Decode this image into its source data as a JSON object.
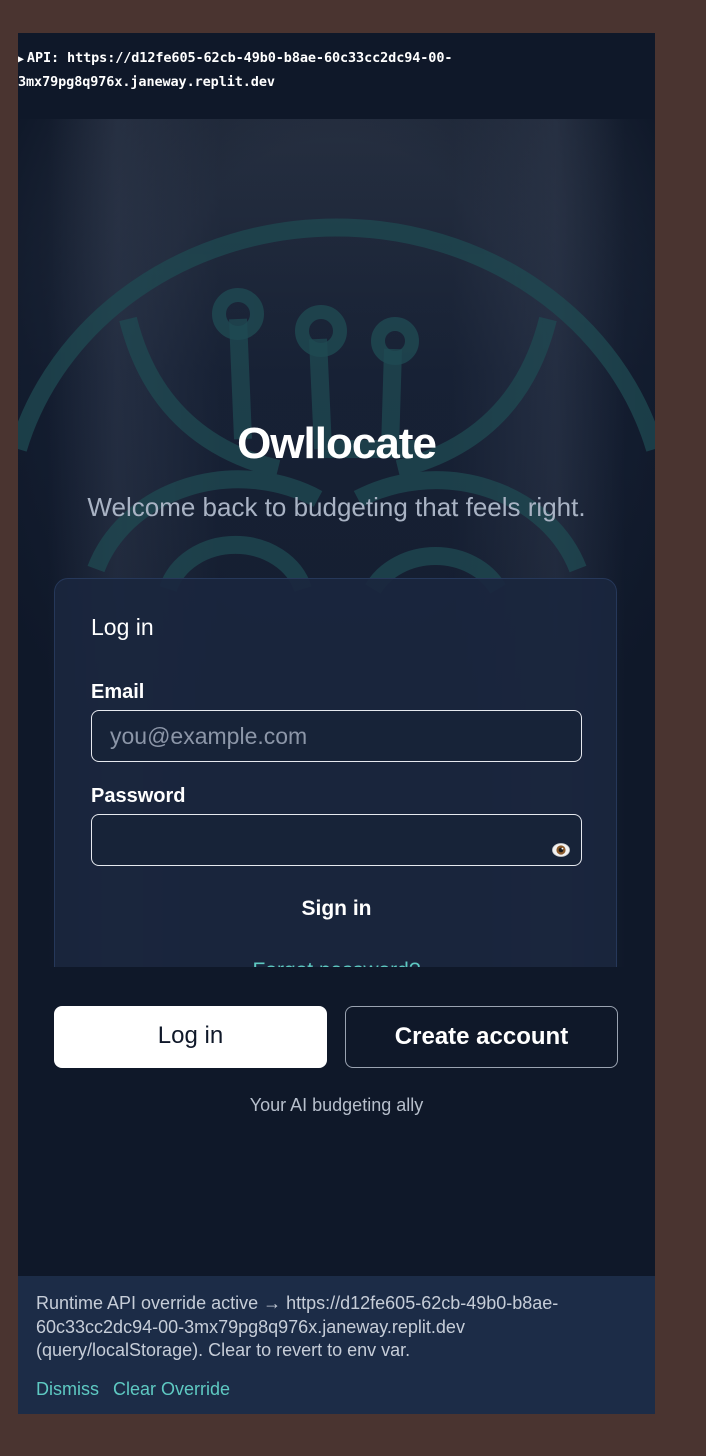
{
  "debug": {
    "api_label": "API: https://d12fe605-62cb-49b0-b8ae-60c33cc2dc94-00-3mx79pg8q976x.janeway.replit.dev",
    "api_line1": "API: https://d12fe605-62cb-49b0-b8ae-60c33cc2dc94-00-",
    "api_line2": "3mx79pg8q976x.janeway.replit.dev"
  },
  "hero": {
    "title": "Owllocate",
    "subtitle": "Welcome back to budgeting that feels right."
  },
  "login_card": {
    "title": "Log in",
    "email_label": "Email",
    "email_placeholder": "you@example.com",
    "email_value": "",
    "password_label": "Password",
    "password_value": "",
    "toggle_icon": "eye-icon",
    "signin_label": "Sign in",
    "forgot_label": "Forgot password?"
  },
  "actions": {
    "login_label": "Log in",
    "create_label": "Create account"
  },
  "tagline": "Your AI budgeting ally",
  "banner": {
    "text": "Runtime API override active → https://d12fe605-62cb-49b0-b8ae-60c33cc2dc94-00-3mx79pg8q976x.janeway.replit.dev (query/localStorage). Clear to revert to env var.",
    "dismiss_label": "Dismiss",
    "clear_label": "Clear Override"
  },
  "colors": {
    "background": "#0f1829",
    "card": "#1a263e",
    "accent": "#5ec9c2",
    "banner": "#1c2c47"
  }
}
